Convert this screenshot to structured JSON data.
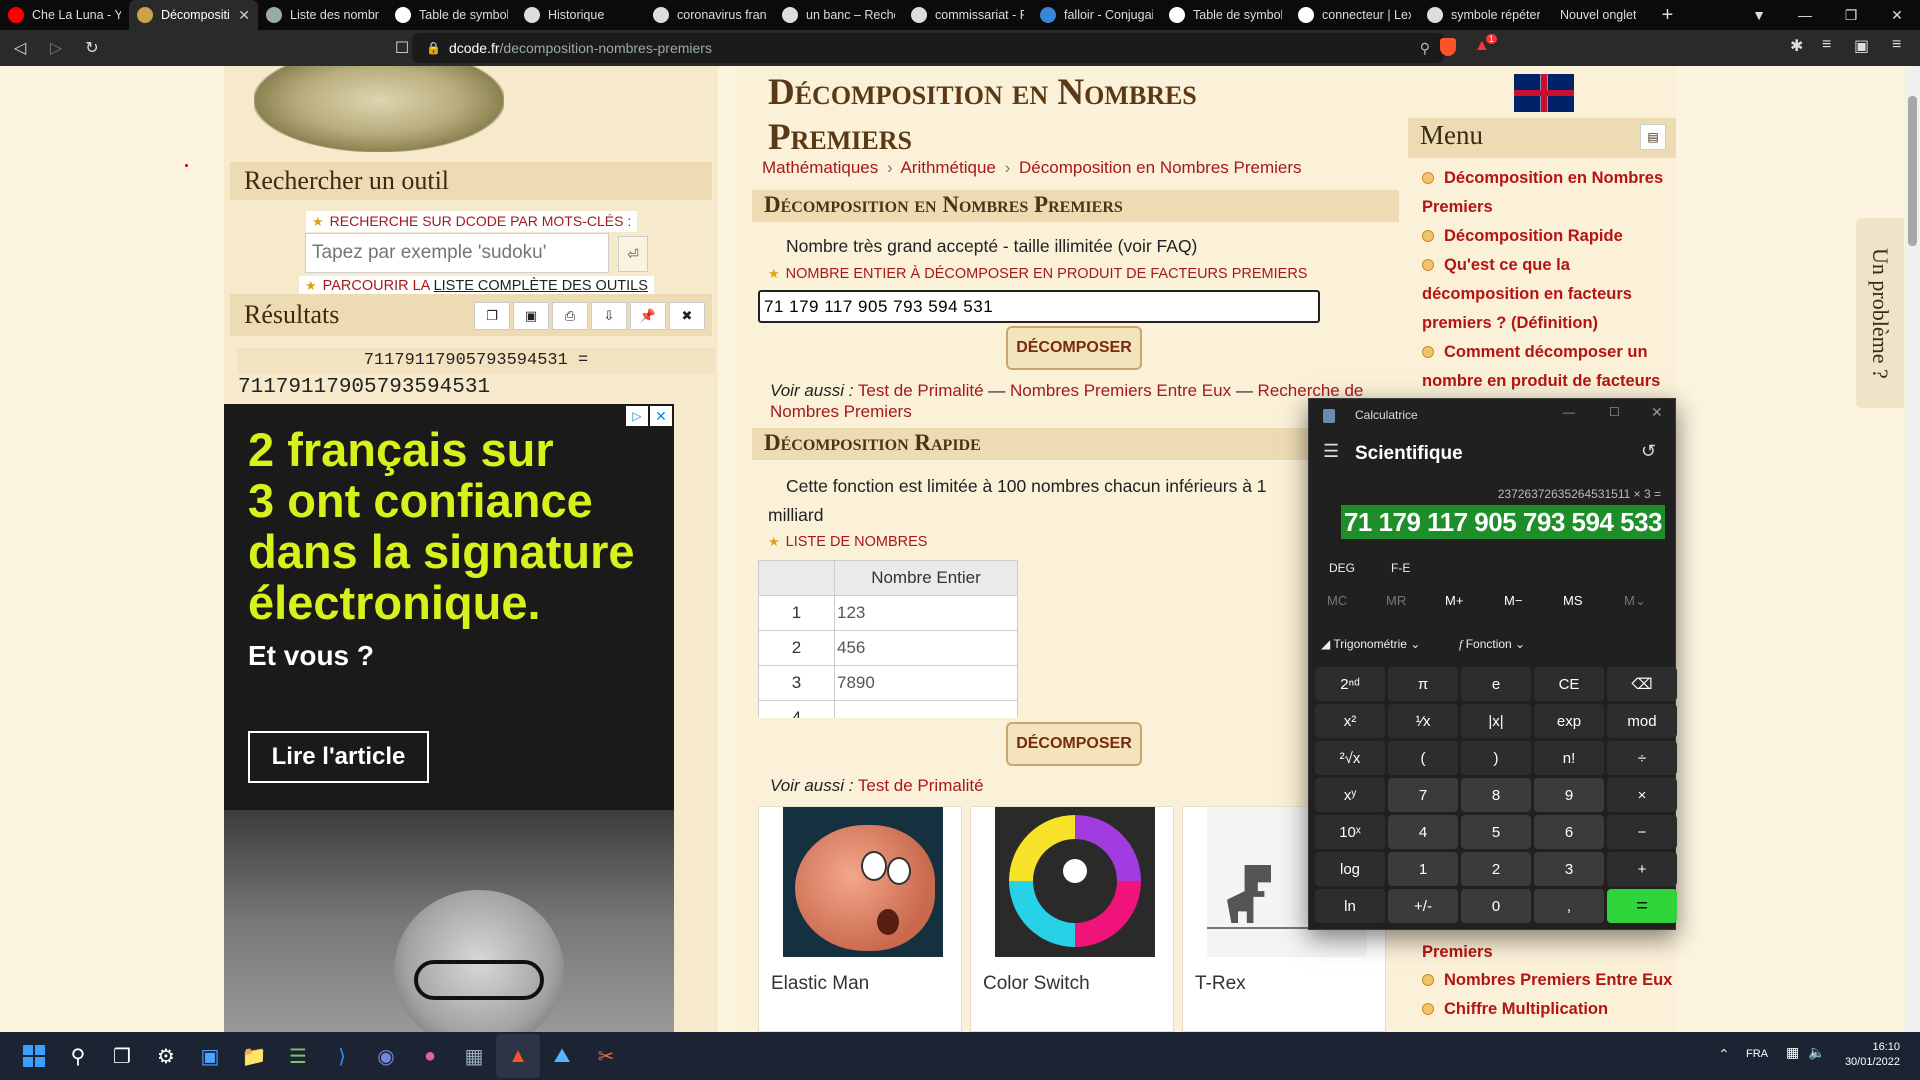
{
  "browser": {
    "tabs": [
      {
        "title": "Che La Luna - Yo",
        "favicon": "youtube-icon",
        "color": "#ff0000"
      },
      {
        "title": "Décompositi",
        "favicon": "dcode-icon",
        "color": "#c9a24a",
        "active": true
      },
      {
        "title": "Liste des nombre",
        "favicon": "globe-icon",
        "color": "#9aa"
      },
      {
        "title": "Table de symbole",
        "favicon": "wikipedia-icon",
        "color": "#fff"
      },
      {
        "title": "Historique",
        "favicon": "history-icon",
        "color": "#ddd"
      },
      {
        "title": "coronavirus franc",
        "favicon": "google-icon",
        "color": "#ddd"
      },
      {
        "title": "un banc – Recher",
        "favicon": "google-icon",
        "color": "#ddd"
      },
      {
        "title": "commissariat - R",
        "favicon": "google-icon",
        "color": "#ddd"
      },
      {
        "title": "falloir - Conjugai",
        "favicon": "conjugaison-icon",
        "color": "#3a86d6"
      },
      {
        "title": "Table de symbole",
        "favicon": "wikipedia-icon",
        "color": "#fff"
      },
      {
        "title": "connecteur | Lex",
        "favicon": "lexilogos-icon",
        "color": "#fff"
      },
      {
        "title": "symbole répéter",
        "favicon": "google-icon",
        "color": "#ddd"
      },
      {
        "title": "Nouvel onglet",
        "favicon": "",
        "color": ""
      }
    ],
    "url_domain": "dcode.fr",
    "url_path": "/decomposition-nombres-premiers",
    "shield_badge": "1"
  },
  "left": {
    "search_heading": "Rechercher un outil",
    "keyword_label": "RECHERCHE SUR DCODE PAR MOTS-CLÉS :",
    "search_placeholder": "Tapez par exemple 'sudoku'",
    "browse_prefix": "PARCOURIR LA ",
    "browse_link": "LISTE COMPLÈTE DES OUTILS",
    "results_heading": "Résultats",
    "result_expr": "71179117905793594531 =",
    "result_value": "71179117905793594531",
    "ad_headline_1": "2 français sur",
    "ad_headline_2": "3 ont confiance",
    "ad_headline_3": "dans la signature",
    "ad_headline_4": "électronique.",
    "ad_sub": "Et vous ?",
    "ad_button": "Lire l'article"
  },
  "main": {
    "title_1": "Décomposition en Nombres",
    "title_2": "Premiers",
    "breadcrumb": [
      "Mathématiques",
      "Arithmétique",
      "Décomposition en Nombres Premiers"
    ],
    "section1_heading": "Décomposition en Nombres Premiers",
    "section1_note": "Nombre très grand accepté - taille illimitée (voir FAQ)",
    "input_label": "NOMBRE ENTIER À DÉCOMPOSER EN PRODUIT DE FACTEURS PREMIERS",
    "input_value": "71 179 117 905 793 594 531",
    "decompose_button": "DÉCOMPOSER",
    "see_also_label": "Voir aussi :",
    "see_also_links": [
      "Test de Primalité",
      "Nombres Premiers Entre Eux",
      "Recherche de Nombres Premiers"
    ],
    "section2_heading": "Décomposition Rapide",
    "section2_note_1": "Cette fonction est limitée à 100 nombres chacun inférieurs à 1",
    "section2_note_2": "milliard",
    "list_label": "LISTE DE NOMBRES",
    "table_header": "Nombre Entier",
    "table_rows": [
      {
        "index": "1",
        "value": "123"
      },
      {
        "index": "2",
        "value": "456"
      },
      {
        "index": "3",
        "value": "7890"
      },
      {
        "index": "4",
        "value": ""
      }
    ],
    "decompose_button_2": "DÉCOMPOSER",
    "see_also_links_2": [
      "Test de Primalité"
    ],
    "games": [
      {
        "name": "Elastic Man"
      },
      {
        "name": "Color Switch"
      },
      {
        "name": "T-Rex"
      }
    ]
  },
  "right": {
    "menu_heading": "Menu",
    "menu_items_top": [
      "Décomposition en Nombres Premiers",
      "Décomposition Rapide",
      "Qu'est ce que la décomposition en facteurs premiers ? (Définition)",
      "Comment décomposer un nombre en produit de facteurs"
    ],
    "menu_items_bottom_partial": "Premiers",
    "menu_items_bottom": [
      "Nombres Premiers Entre Eux",
      "Chiffre Multiplication"
    ],
    "side_tab": "Un problème ?"
  },
  "calculator": {
    "window_title": "Calculatrice",
    "mode": "Scientifique",
    "expression": "23726372635264531511 × 3 =",
    "display": "71 179 117 905 793 594 533",
    "deg": "DEG",
    "fe": "F-E",
    "memory": [
      "MC",
      "MR",
      "M+",
      "M−",
      "MS",
      "M⌄"
    ],
    "trig_label": "Trigonométrie",
    "func_label": "Fonction",
    "keys": [
      [
        "2ⁿᵈ",
        "π",
        "e",
        "CE",
        "⌫"
      ],
      [
        "x²",
        "¹⁄x",
        "|x|",
        "exp",
        "mod"
      ],
      [
        "²√x",
        "(",
        ")",
        "n!",
        "÷"
      ],
      [
        "xʸ",
        "7",
        "8",
        "9",
        "×"
      ],
      [
        "10ˣ",
        "4",
        "5",
        "6",
        "−"
      ],
      [
        "log",
        "1",
        "2",
        "3",
        "+"
      ],
      [
        "ln",
        "+/-",
        "0",
        ",",
        "="
      ]
    ]
  },
  "taskbar": {
    "language": "FRA",
    "time": "16:10",
    "date": "30/01/2022"
  }
}
